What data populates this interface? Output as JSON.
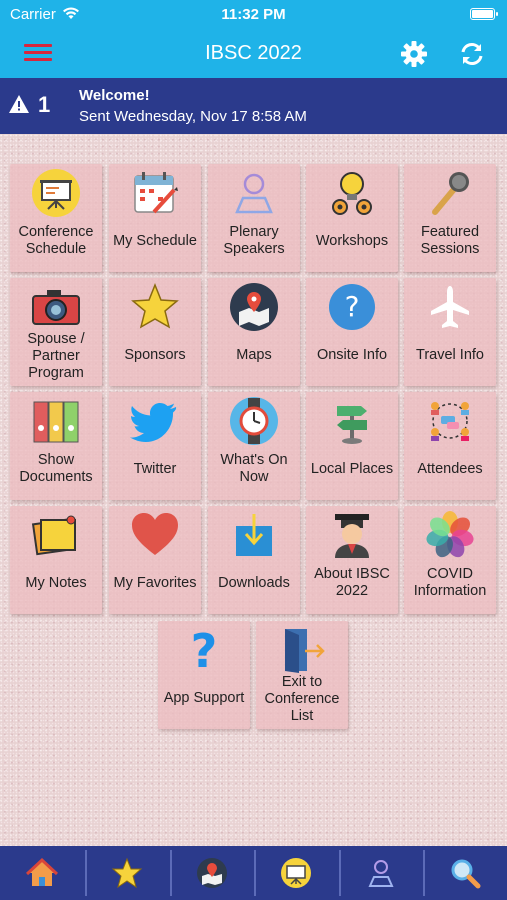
{
  "status_bar": {
    "carrier": "Carrier",
    "time": "11:32 PM"
  },
  "header": {
    "title": "IBSC 2022",
    "icons": [
      "menu-icon",
      "gear-icon",
      "refresh-icon"
    ]
  },
  "banner": {
    "count": "1",
    "title": "Welcome!",
    "subtitle": "Sent Wednesday, Nov 17 8:58 AM"
  },
  "tiles": [
    {
      "label": "Conference Schedule",
      "icon": "presentation-icon"
    },
    {
      "label": "My Schedule",
      "icon": "calendar-icon"
    },
    {
      "label": "Plenary Speakers",
      "icon": "speaker-icon"
    },
    {
      "label": "Workshops",
      "icon": "lightbulb-gears-icon"
    },
    {
      "label": "Featured Sessions",
      "icon": "microphone-icon"
    },
    {
      "label": "Spouse / Partner Program",
      "icon": "camera-icon"
    },
    {
      "label": "Sponsors",
      "icon": "star-icon"
    },
    {
      "label": "Maps",
      "icon": "map-pin-icon"
    },
    {
      "label": "Onsite Info",
      "icon": "question-circle-icon"
    },
    {
      "label": "Travel Info",
      "icon": "airplane-icon"
    },
    {
      "label": "Show Documents",
      "icon": "binders-icon"
    },
    {
      "label": "Twitter",
      "icon": "twitter-icon"
    },
    {
      "label": "What's On Now",
      "icon": "watch-icon"
    },
    {
      "label": "Local Places",
      "icon": "signpost-icon"
    },
    {
      "label": "Attendees",
      "icon": "people-network-icon"
    },
    {
      "label": "My Notes",
      "icon": "sticky-note-icon"
    },
    {
      "label": "My Favorites",
      "icon": "heart-icon"
    },
    {
      "label": "Downloads",
      "icon": "download-box-icon"
    },
    {
      "label": "About IBSC 2022",
      "icon": "graduate-icon"
    },
    {
      "label": "COVID Information",
      "icon": "flower-icon"
    },
    {
      "label": "App Support",
      "icon": "question-mark-icon"
    },
    {
      "label": "Exit to Conference List",
      "icon": "exit-door-icon"
    }
  ],
  "tabbar": [
    "home-icon",
    "star-icon",
    "map-pin-icon",
    "presentation-icon",
    "speaker-icon",
    "search-icon"
  ],
  "colors": {
    "header": "#1fb3e8",
    "banner": "#2b3a8c",
    "tabbar": "#2b3a8c",
    "menu": "#d7263d"
  }
}
